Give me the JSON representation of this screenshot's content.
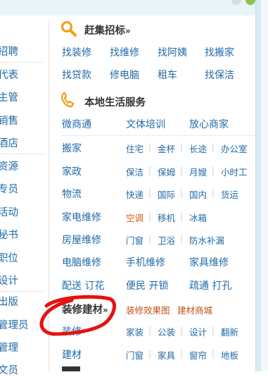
{
  "left_menu": {
    "items": [
      "招聘",
      "代表",
      "主管",
      "销售",
      "酒店",
      "资源",
      "专员",
      "活动",
      "秘书",
      "职位",
      "设计",
      "出版",
      "管理员",
      "管理",
      "文员"
    ]
  },
  "section_ganji": {
    "title": "赶集招标",
    "arrow": "»",
    "icon": "search-icon",
    "row1": [
      "找装修",
      "找维修",
      "找阿姨",
      "找搬家"
    ],
    "row2": [
      "找贷款",
      "修电脑",
      "租车",
      "找保洁"
    ]
  },
  "section_local": {
    "title": "本地生活服务",
    "icon": "phone-icon",
    "top_row": [
      "微商通",
      "文体培训",
      "放心商家"
    ],
    "rows": [
      {
        "cat": "搬家",
        "subs": [
          "住宅",
          "金杯",
          "长途",
          "办公室"
        ]
      },
      {
        "cat": "家政",
        "subs": [
          "保洁",
          "保姆",
          "月嫂",
          "小时工"
        ]
      },
      {
        "cat": "物流",
        "subs": [
          "快递",
          "国际",
          "国内",
          "货运"
        ]
      },
      {
        "cat": "家电维修",
        "subs": [
          "空调",
          "移机",
          "冰箱"
        ]
      },
      {
        "cat": "房屋维修",
        "subs": [
          "门窗",
          "卫浴",
          "防水补漏"
        ]
      },
      {
        "cat": "电脑维修",
        "subs": [
          "手机维修",
          "家具维修"
        ]
      },
      {
        "cat": "配送 订花",
        "subs": [
          "便民 开锁",
          "疏通 打孔"
        ]
      }
    ]
  },
  "section_decor": {
    "title": "装修建材",
    "arrow": "»",
    "links": [
      "装修效果图",
      "建材商城"
    ],
    "rows": [
      {
        "cat": "装修",
        "subs": [
          "家装",
          "公装",
          "设计",
          "翻新"
        ]
      },
      {
        "cat": "建材",
        "subs": [
          "门窗",
          "家具",
          "窗帘",
          "地板"
        ]
      }
    ],
    "annotation_color": "#e81010"
  },
  "colors": {
    "link": "#1f6aa8",
    "title": "#333333",
    "accent_orange": "#f39c12",
    "red_link": "#e05a1a"
  }
}
